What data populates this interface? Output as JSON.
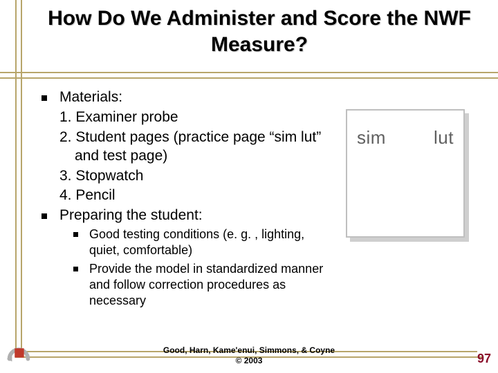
{
  "title": "How Do We Administer and Score the NWF Measure?",
  "sections": {
    "materials_label": "Materials:",
    "materials_items": {
      "n1": "1.  Examiner probe",
      "n2": "2.  Student pages (practice page “sim   lut” and test page)",
      "n3": "3.  Stopwatch",
      "n4": "4.  Pencil"
    },
    "preparing_label": "Preparing the student:",
    "preparing_items": {
      "s1": "Good testing conditions  (e. g. , lighting, quiet, comfortable)",
      "s2": "Provide the model in standardized manner and follow correction procedures as necessary"
    }
  },
  "card": {
    "left_word": "sim",
    "right_word": "lut"
  },
  "footer": {
    "line1": "Good, Harn, Kame'enui, Simmons, & Coyne",
    "line2": "© 2003"
  },
  "page_number": "97"
}
